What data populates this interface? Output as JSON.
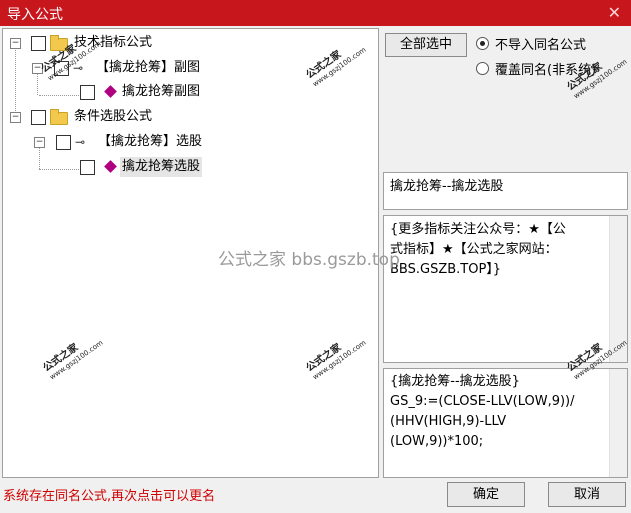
{
  "window": {
    "title": "导入公式",
    "close_glyph": "✕"
  },
  "tree": {
    "nodes": [
      {
        "label": "技术指标公式"
      },
      {
        "label": "【擒龙抢筹】副图"
      },
      {
        "label": "擒龙抢筹副图"
      },
      {
        "label": "条件选股公式"
      },
      {
        "label": "【擒龙抢筹】选股"
      },
      {
        "label": "擒龙抢筹选股"
      }
    ]
  },
  "options": {
    "select_all_label": "全部选中",
    "radio_no_import": "不导入同名公式",
    "radio_overwrite": "覆盖同名(非系统)",
    "selected": "no_import"
  },
  "formula_name": "擒龙抢筹--擒龙选股",
  "description": [
    "{更多指标关注公众号：★【公",
    "式指标】★【公式之家网站：",
    "BBS.GSZB.TOP】}"
  ],
  "code": [
    "{擒龙抢筹--擒龙选股}",
    "GS_9:=(CLOSE-LLV(LOW,9))/",
    "(HHV(HIGH,9)-LLV",
    "(LOW,9))*100;"
  ],
  "status_message": "系统存在同名公式,再次点击可以更名",
  "buttons": {
    "ok": "确定",
    "cancel": "取消"
  },
  "watermark": {
    "cn": "公式之家",
    "url": "www.gszj100.com",
    "center_text": "公式之家 bbs.gszb.top"
  }
}
